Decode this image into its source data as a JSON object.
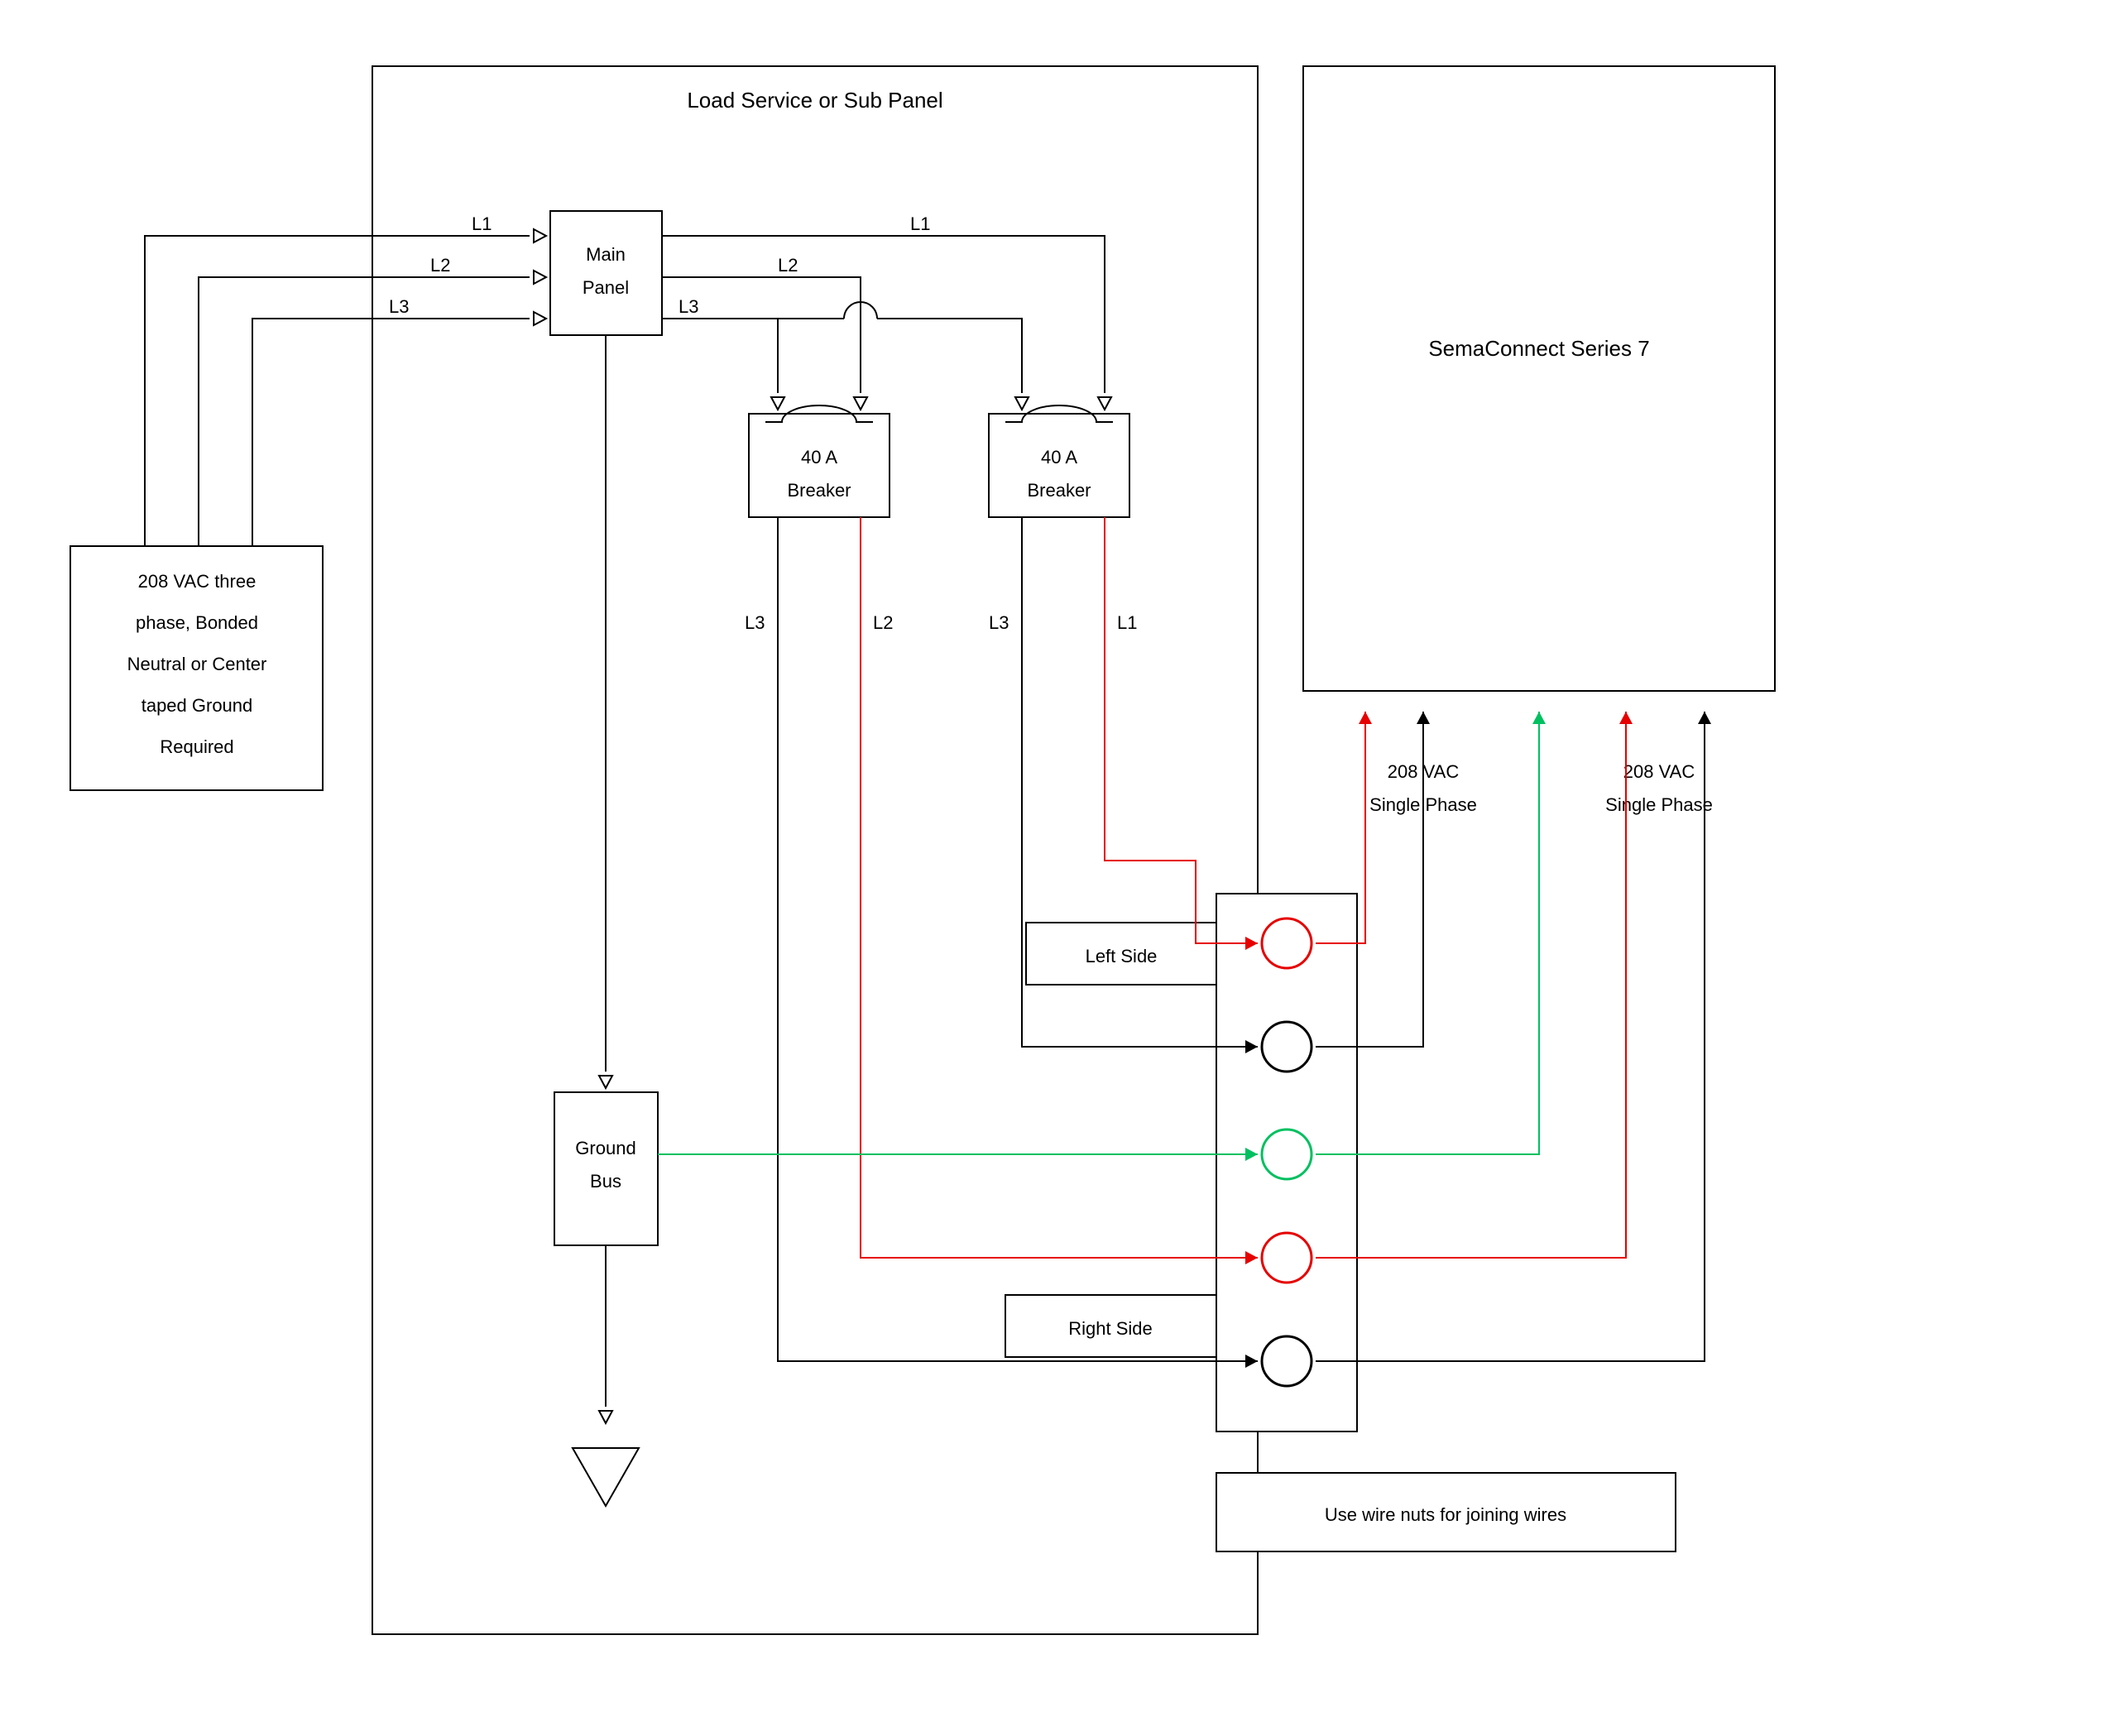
{
  "diagram": {
    "service_panel_title": "Load Service or Sub Panel",
    "source_box": {
      "l1": "208 VAC three",
      "l2": "phase, Bonded",
      "l3": "Neutral or Center",
      "l4": "taped Ground",
      "l5": "Required"
    },
    "main_panel": {
      "l1": "Main",
      "l2": "Panel"
    },
    "phase_labels": {
      "L1": "L1",
      "L2": "L2",
      "L3": "L3"
    },
    "breaker1": {
      "l1": "40 A",
      "l2": "Breaker"
    },
    "breaker2": {
      "l1": "40 A",
      "l2": "Breaker"
    },
    "breaker1_out": {
      "left": "L3",
      "right": "L2"
    },
    "breaker2_out": {
      "left": "L3",
      "right": "L1"
    },
    "ground_bus": {
      "l1": "Ground",
      "l2": "Bus"
    },
    "terminal_box": {
      "left_side": "Left Side",
      "right_side": "Right Side"
    },
    "wire_nuts_note": "Use wire nuts for joining wires",
    "device_box": "SemaConnect Series 7",
    "phase_out_left": {
      "l1": "208 VAC",
      "l2": "Single Phase"
    },
    "phase_out_right": {
      "l1": "208 VAC",
      "l2": "Single Phase"
    }
  },
  "colors": {
    "black": "#000000",
    "red": "#e60000",
    "green": "#00c060"
  }
}
